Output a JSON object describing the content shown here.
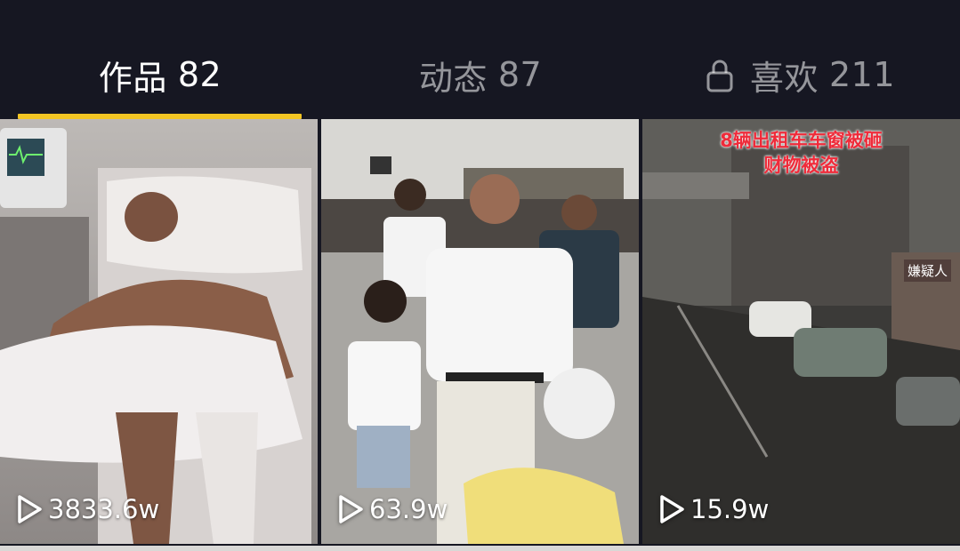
{
  "tabs": {
    "works": {
      "label": "作品",
      "count": "82"
    },
    "dynamic": {
      "label": "动态",
      "count": "87"
    },
    "likes": {
      "label": "喜欢",
      "count": "211",
      "icon": "lock-icon"
    }
  },
  "colors": {
    "background": "#161722",
    "active_underline": "#f2c523",
    "overlay_red": "#ef2b3a"
  },
  "videos": [
    {
      "play_count": "3833.6w",
      "description": "hospital-bed-patient"
    },
    {
      "play_count": "63.9w",
      "description": "station-crowd"
    },
    {
      "play_count": "15.9w",
      "overlay_lines": [
        "8辆出租车车窗被砸",
        "财物被盗"
      ],
      "tag": "嫌疑人"
    }
  ]
}
